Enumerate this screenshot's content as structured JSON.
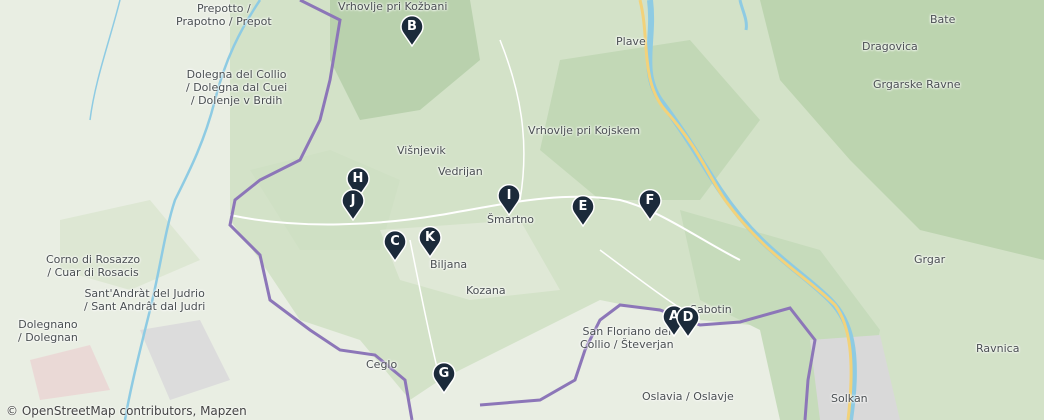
{
  "map": {
    "places": [
      {
        "id": "prepotto",
        "text": "Prepotto /\nPrapotno / Prepot"
      },
      {
        "id": "vrhovlje-kozbani",
        "text": "Vrhovlje pri Kožbani"
      },
      {
        "id": "dolegna",
        "text": "Dolegna del Collio\n/ Dolegna dal Cuei\n/ Dolenje v Brdih"
      },
      {
        "id": "bate",
        "text": "Bate"
      },
      {
        "id": "dragovica",
        "text": "Dragovica"
      },
      {
        "id": "plave",
        "text": "Plave"
      },
      {
        "id": "grgarske-ravne",
        "text": "Grgarske Ravne"
      },
      {
        "id": "vrhovlje-kojskem",
        "text": "Vrhovlje pri Kojskem"
      },
      {
        "id": "visnjevik",
        "text": "Višnjevik"
      },
      {
        "id": "vedrijan",
        "text": "Vedrijan"
      },
      {
        "id": "smartno",
        "text": "Šmartno"
      },
      {
        "id": "biljana",
        "text": "Biljana"
      },
      {
        "id": "corno",
        "text": "Corno di Rosazzo\n/ Cuar di Rosacis"
      },
      {
        "id": "santandrat",
        "text": "Sant'Andràt del Judrio\n/ Sant Andrât dal Judri"
      },
      {
        "id": "kozana",
        "text": "Kozana"
      },
      {
        "id": "grgar",
        "text": "Grgar"
      },
      {
        "id": "dolegnano",
        "text": "Dolegnano\n/ Dolegnan"
      },
      {
        "id": "sabotin",
        "text": "Sabotin"
      },
      {
        "id": "san-floriano",
        "text": "San Floriano del\nCollio / Števerjan"
      },
      {
        "id": "ravnica",
        "text": "Ravnica"
      },
      {
        "id": "ceglo",
        "text": "Ceglo"
      },
      {
        "id": "oslavia",
        "text": "Oslavia / Oslavje"
      },
      {
        "id": "solkan",
        "text": "Solkan"
      }
    ],
    "markers": [
      {
        "label": "B"
      },
      {
        "label": "H"
      },
      {
        "label": "J"
      },
      {
        "label": "I"
      },
      {
        "label": "E"
      },
      {
        "label": "F"
      },
      {
        "label": "C"
      },
      {
        "label": "K"
      },
      {
        "label": "A"
      },
      {
        "label": "D"
      },
      {
        "label": "G"
      }
    ],
    "attribution": "© OpenStreetMap contributors, Mapzen",
    "colors": {
      "land": "#e9eee3",
      "forest": "#c8dcc0",
      "hills": "#b9d1ad",
      "river": "#8ecbe3",
      "road": "#f2d27a",
      "border": "#8c76b8",
      "marker": "#1b2a3a",
      "urban": "#d9d9d9"
    }
  }
}
